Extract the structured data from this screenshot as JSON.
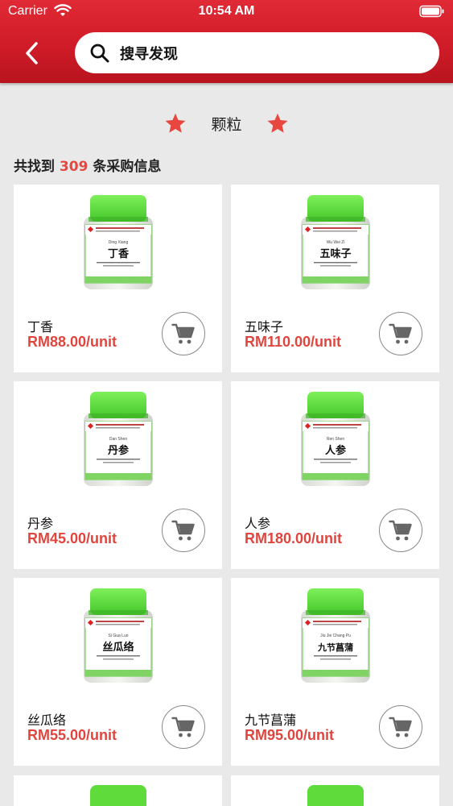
{
  "status_bar": {
    "carrier": "Carrier",
    "time": "10:54 AM"
  },
  "search": {
    "placeholder": "搜寻发现"
  },
  "category": {
    "title": "颗粒"
  },
  "results": {
    "prefix": "共找到 ",
    "count": "309",
    "suffix": " 条采购信息"
  },
  "colors": {
    "header_red": "#d01c28",
    "accent_red": "#e8473f",
    "lid_green": "#5fdc3c"
  },
  "products": [
    {
      "name": "丁香",
      "price": "RM88.00/unit",
      "label_cn": "丁香",
      "label_en": "Ding Xiang"
    },
    {
      "name": "五味子",
      "price": "RM110.00/unit",
      "label_cn": "五味子",
      "label_en": "Wu Wei Zi"
    },
    {
      "name": "丹参",
      "price": "RM45.00/unit",
      "label_cn": "丹参",
      "label_en": "Dan Shen"
    },
    {
      "name": "人参",
      "price": "RM180.00/unit",
      "label_cn": "人参",
      "label_en": "Ren Shen"
    },
    {
      "name": "丝瓜络",
      "price": "RM55.00/unit",
      "label_cn": "丝瓜络",
      "label_en": "Si Gua Luo"
    },
    {
      "name": "九节菖蒲",
      "price": "RM95.00/unit",
      "label_cn": "九节菖蒲",
      "label_en": "Jiu Jie Chang Pu"
    }
  ],
  "icons": {
    "back": "chevron-left-icon",
    "search": "search-icon",
    "star": "star-icon",
    "cart": "cart-icon",
    "wifi": "wifi-icon",
    "battery": "battery-icon"
  }
}
